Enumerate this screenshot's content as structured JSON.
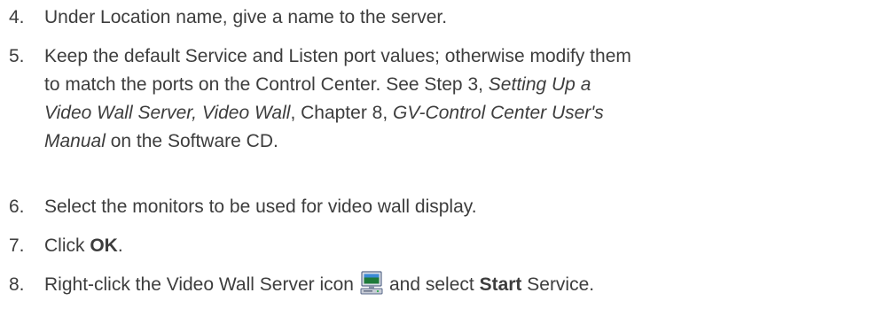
{
  "steps": [
    {
      "number": "4.",
      "text": "Under Location name, give a name to the server."
    },
    {
      "number": "5.",
      "line1": "Keep the default Service and Listen port values; otherwise modify them",
      "line2_a": "to match the ports on the Control Center. See Step 3, ",
      "line2_b": "Setting Up a",
      "line3_a": "Video Wall Server, Video Wall",
      "line3_b": ", Chapter 8, ",
      "line3_c": "GV-Control Center User's",
      "line4_a": "Manual",
      "line4_b": " on the Software CD."
    },
    {
      "number": "6.",
      "text": "Select the monitors to be used for video wall display."
    },
    {
      "number": "7.",
      "text_a": "Click ",
      "text_b": "OK",
      "text_c": "."
    },
    {
      "number": "8.",
      "text_a": "Right-click the Video Wall Server icon",
      "icon": "video-wall-server-icon",
      "text_b": "and select ",
      "text_c": "Start",
      "text_d": " Service."
    }
  ]
}
